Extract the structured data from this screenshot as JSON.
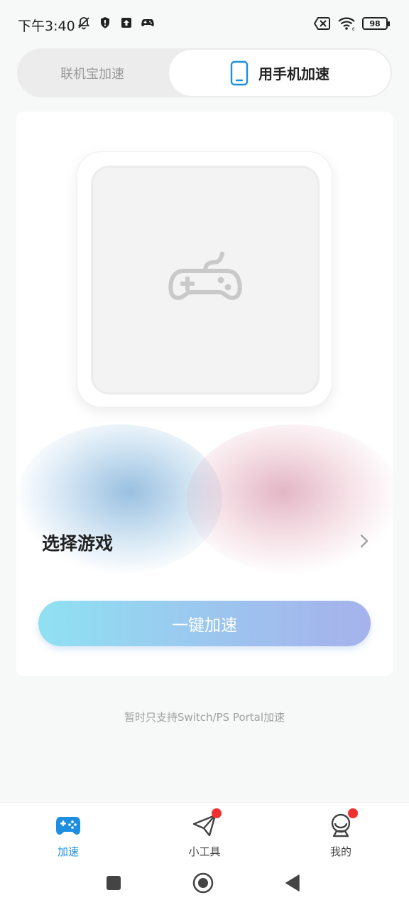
{
  "status_bar": {
    "time": "下午3:40",
    "battery": "98",
    "left_icons": [
      "mute-bell-icon",
      "shield-icon",
      "upload-icon",
      "gamepad-icon"
    ],
    "right_icons": [
      "sim-x-icon",
      "wifi-icon",
      "battery-icon"
    ]
  },
  "mode_switch": {
    "left_label": "联机宝加速",
    "right_label": "用手机加速",
    "selected": "用手机加速"
  },
  "card": {
    "device_icon": "gamepad-icon",
    "select_label": "选择游戏",
    "boost_label": "一键加速"
  },
  "note": "暂时只支持Switch/PS Portal加速",
  "bottom_nav": {
    "items": [
      {
        "label": "加速",
        "icon": "gamepad-icon",
        "active": true,
        "badge": false
      },
      {
        "label": "小工具",
        "icon": "paper-plane-icon",
        "active": false,
        "badge": true
      },
      {
        "label": "我的",
        "icon": "profile-icon",
        "active": false,
        "badge": true
      }
    ]
  },
  "colors": {
    "accent": "#1e8fe0",
    "badge": "#f23030",
    "button_gradient_start": "#8fe1f2",
    "button_gradient_end": "#a5b2ec"
  }
}
